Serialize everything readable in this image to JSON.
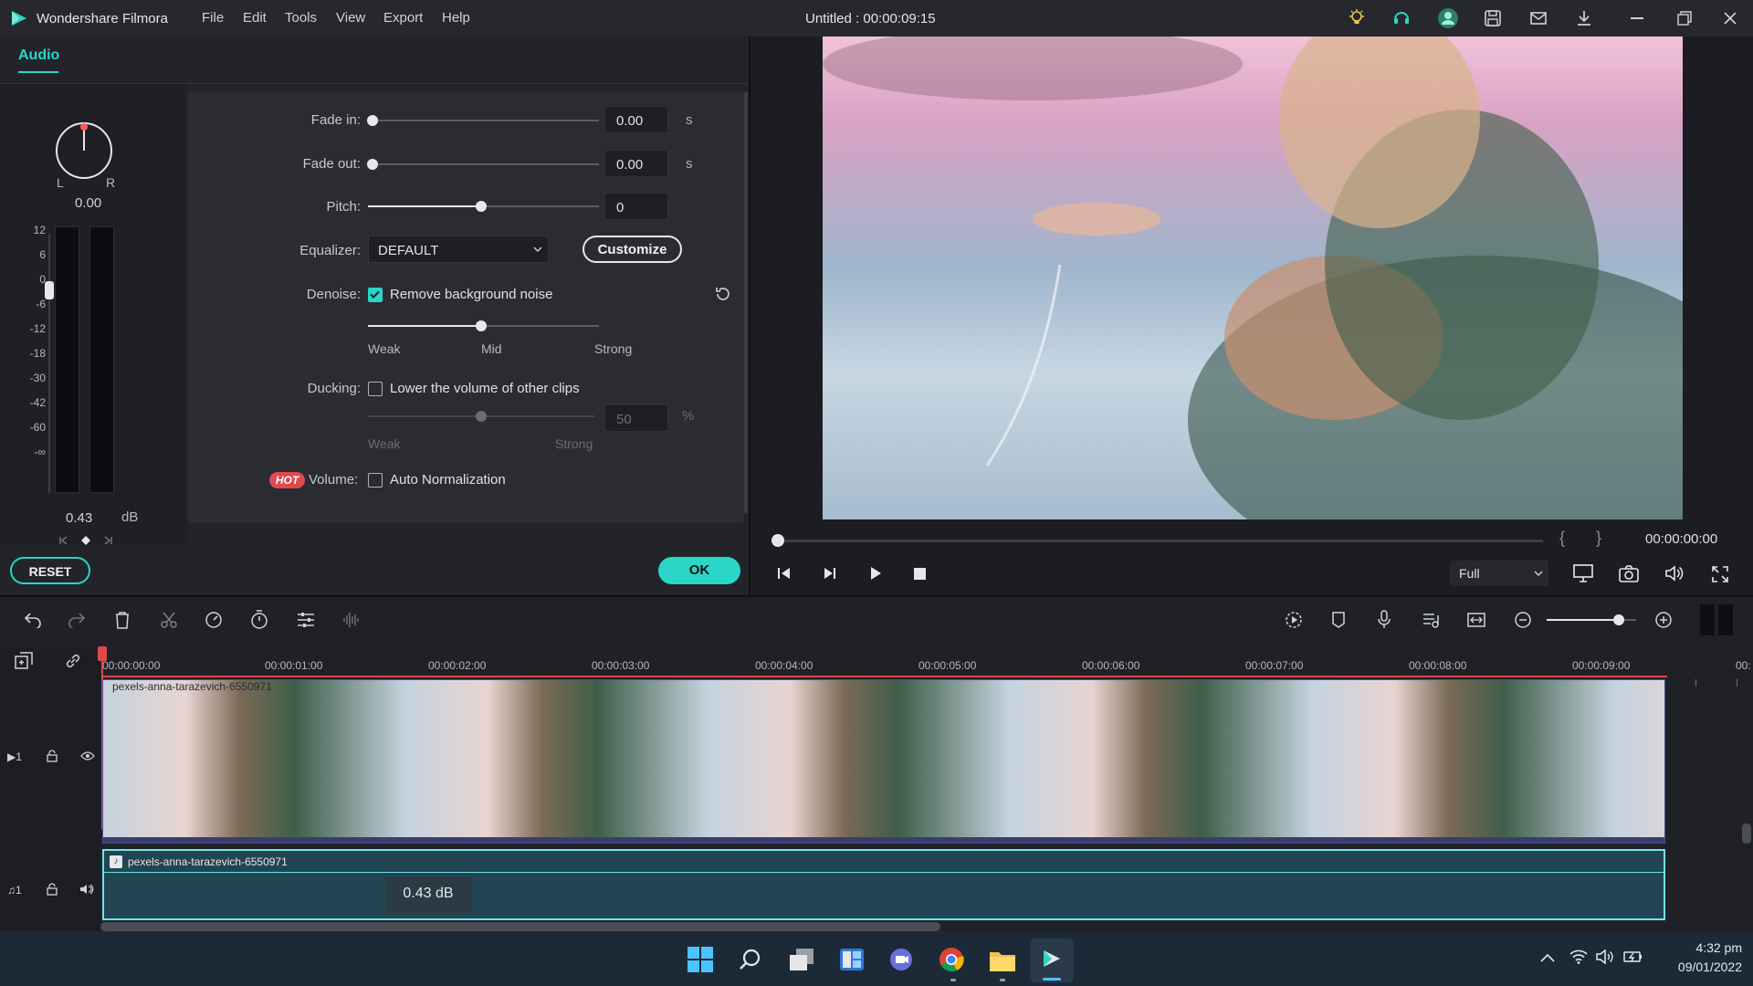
{
  "app": {
    "name": "Wondershare Filmora",
    "title": "Untitled : 00:00:09:15",
    "menu": [
      "File",
      "Edit",
      "Tools",
      "View",
      "Export",
      "Help"
    ]
  },
  "audio_panel": {
    "tab": "Audio",
    "pan": {
      "left": "L",
      "right": "R",
      "value": "0.00"
    },
    "meter_scale": [
      "12",
      "6",
      "0",
      "-6",
      "-12",
      "-18",
      "-30",
      "-42",
      "-60",
      "-∞"
    ],
    "volume_value": "0.43",
    "volume_unit": "dB",
    "fade_in": {
      "label": "Fade in:",
      "value": "0.00",
      "unit": "s"
    },
    "fade_out": {
      "label": "Fade out:",
      "value": "0.00",
      "unit": "s"
    },
    "pitch": {
      "label": "Pitch:",
      "value": "0"
    },
    "equalizer": {
      "label": "Equalizer:",
      "selected": "DEFAULT",
      "customize": "Customize"
    },
    "denoise": {
      "label": "Denoise:",
      "checkbox": "Remove background noise",
      "checked": true,
      "levels": [
        "Weak",
        "Mid",
        "Strong"
      ]
    },
    "ducking": {
      "label": "Ducking:",
      "checkbox": "Lower the volume of other clips",
      "checked": false,
      "value": "50",
      "unit": "%",
      "levels": [
        "Weak",
        "Strong"
      ]
    },
    "volume": {
      "badge": "HOT",
      "label": "Volume:",
      "checkbox": "Auto Normalization",
      "checked": false
    },
    "reset": "RESET",
    "ok": "OK",
    "accent": "#2ad6c8"
  },
  "preview": {
    "timecode": "00:00:00:00",
    "mark_in": "{",
    "mark_out": "}",
    "quality": "Full"
  },
  "timeline": {
    "ticks": [
      "00:00:00:00",
      "00:00:01:00",
      "00:00:02:00",
      "00:00:03:00",
      "00:00:04:00",
      "00:00:05:00",
      "00:00:06:00",
      "00:00:07:00",
      "00:00:08:00",
      "00:00:09:00",
      "00:"
    ],
    "video_track": {
      "number": "1",
      "clip_name": "pexels-anna-tarazevich-6550971"
    },
    "audio_track": {
      "number": "1",
      "clip_name": "pexels-anna-tarazevich-6550971",
      "gain": "0.43 dB"
    }
  },
  "taskbar": {
    "time": "4:32 pm",
    "date": "09/01/2022"
  }
}
